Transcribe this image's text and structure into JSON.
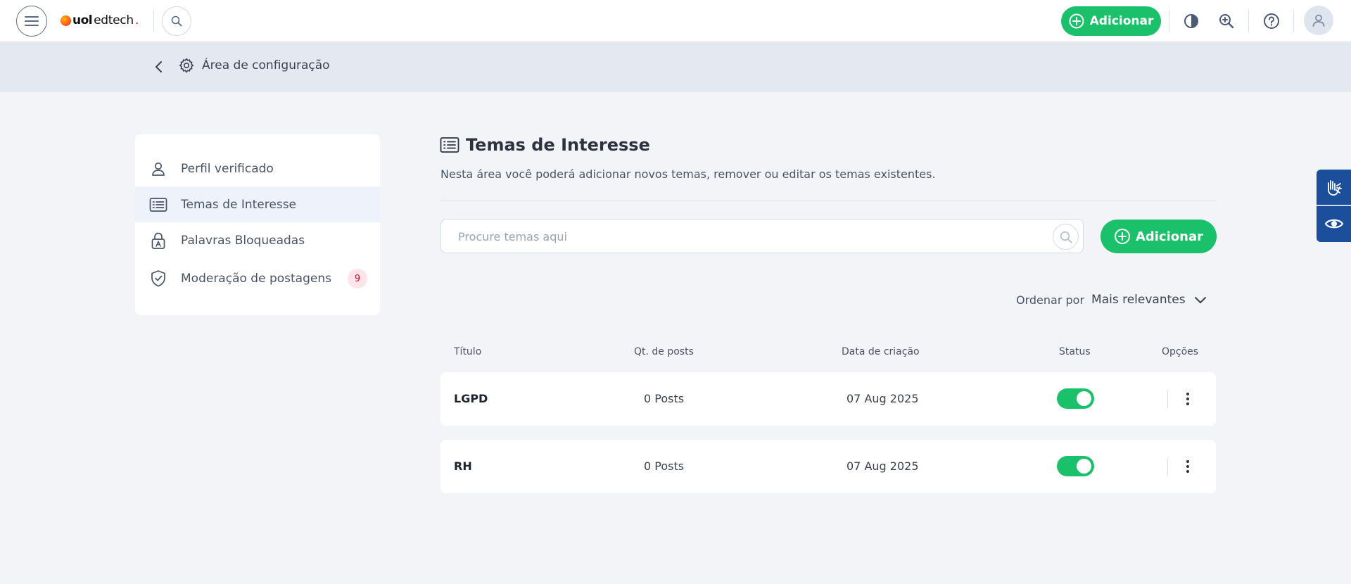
{
  "header": {
    "logo": {
      "bold": "uol",
      "text": "edtech",
      "dot": "."
    },
    "add_label": "Adicionar",
    "icons": [
      "menu-icon",
      "search-icon",
      "plus-circle-icon",
      "contrast-icon",
      "zoom-in-icon",
      "help-icon",
      "user-icon"
    ]
  },
  "subheader": {
    "breadcrumb": "Área de configuração"
  },
  "sidebar": {
    "items": [
      {
        "label": "Perfil verificado",
        "icon": "user-icon"
      },
      {
        "label": "Temas de Interesse",
        "icon": "list-icon",
        "active": true
      },
      {
        "label": "Palavras Bloqueadas",
        "icon": "lock-text-icon"
      },
      {
        "label": "Moderação de postagens",
        "icon": "shield-check-icon",
        "badge": "9"
      }
    ]
  },
  "main": {
    "title": "Temas de Interesse",
    "description": "Nesta área você poderá adicionar novos temas, remover ou editar os temas existentes.",
    "search": {
      "placeholder": "Procure temas aqui",
      "value": ""
    },
    "add_label": "Adicionar",
    "sort": {
      "label": "Ordenar por",
      "value": "Mais relevantes"
    },
    "table": {
      "columns": [
        "Título",
        "Qt. de posts",
        "Data de criação",
        "Status",
        "Opções"
      ],
      "rows": [
        {
          "title": "LGPD",
          "posts": "0 Posts",
          "date": "07 Aug 2025",
          "status_on": true
        },
        {
          "title": "RH",
          "posts": "0 Posts",
          "date": "07 Aug 2025",
          "status_on": true
        }
      ]
    }
  },
  "colors": {
    "accent_green": "#1ac06a",
    "badge_red": "#c8102e",
    "widget_blue": "#1b4f9c"
  }
}
